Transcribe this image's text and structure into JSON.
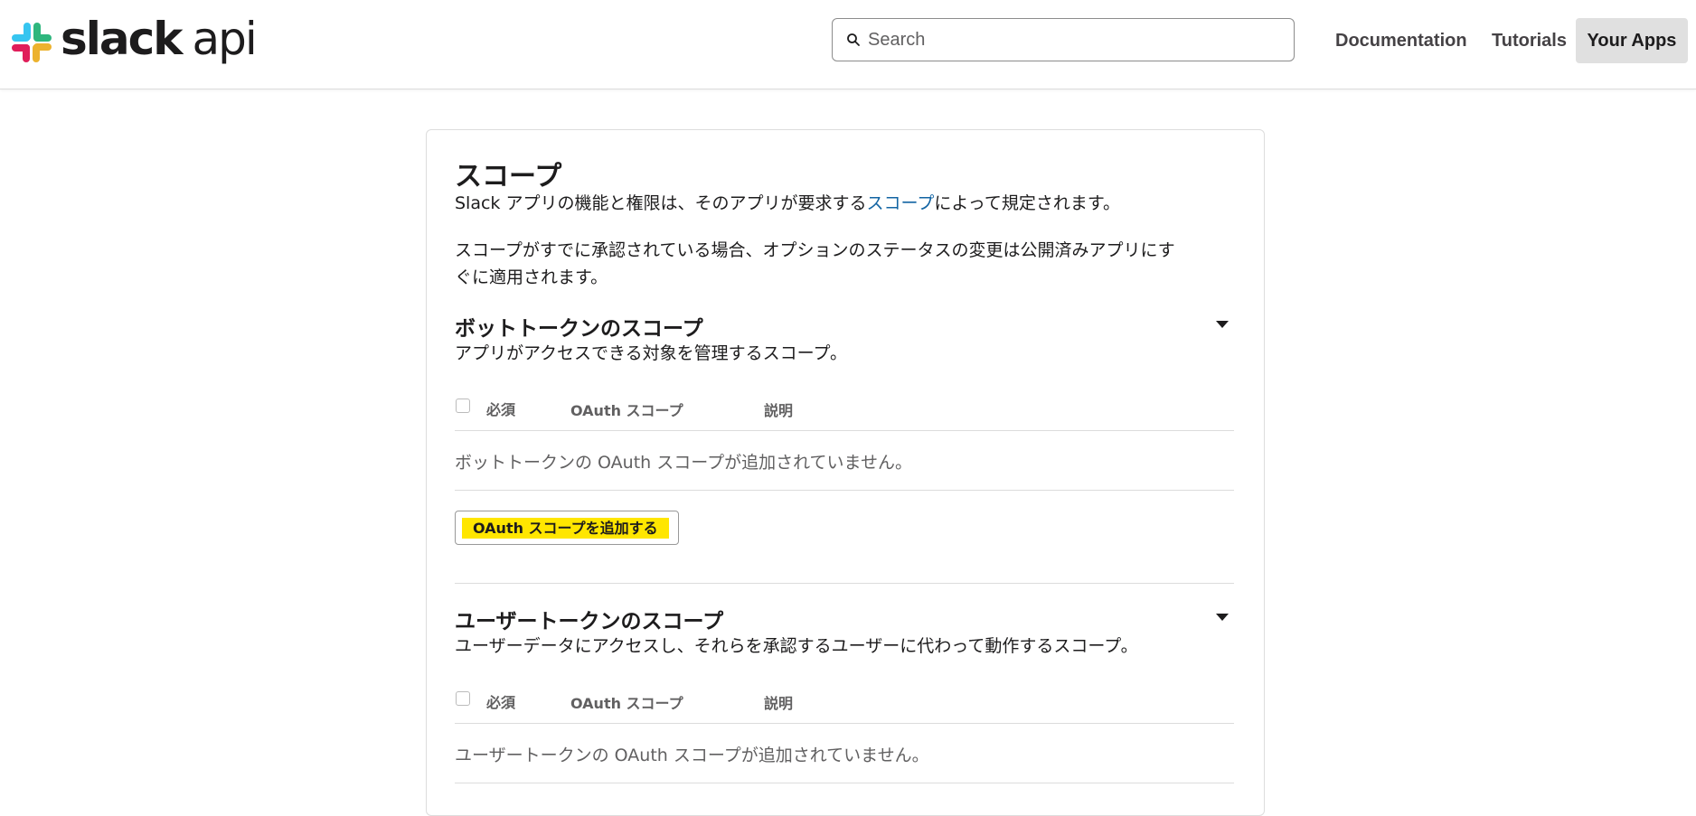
{
  "header": {
    "logo_text_main": "slack",
    "logo_text_sub": "api",
    "search": {
      "placeholder": "Search"
    },
    "nav": [
      "Documentation",
      "Tutorials",
      "Your Apps"
    ]
  },
  "scopes": {
    "title": "スコープ",
    "intro_prefix": "Slack アプリの機能と権限は、そのアプリが要求する",
    "intro_link": "スコープ",
    "intro_suffix": "によって規定されます。",
    "note_line1": "スコープがすでに承認されている場合、オプションのステータスの変更は公開済みアプリにす",
    "note_line2": "ぐに適用されます。",
    "columns": {
      "required": "必須",
      "scope": "OAuth スコープ",
      "description": "説明"
    },
    "bot": {
      "title": "ボットトークンのスコープ",
      "subtitle": "アプリがアクセスできる対象を管理するスコープ。",
      "empty": "ボットトークンの OAuth スコープが追加されていません。",
      "add_button": "OAuth スコープを追加する"
    },
    "user": {
      "title": "ユーザートークンのスコープ",
      "subtitle": "ユーザーデータにアクセスし、それらを承認するユーザーに代わって動作するスコープ。",
      "empty": "ユーザートークンの OAuth スコープが追加されていません。"
    }
  }
}
